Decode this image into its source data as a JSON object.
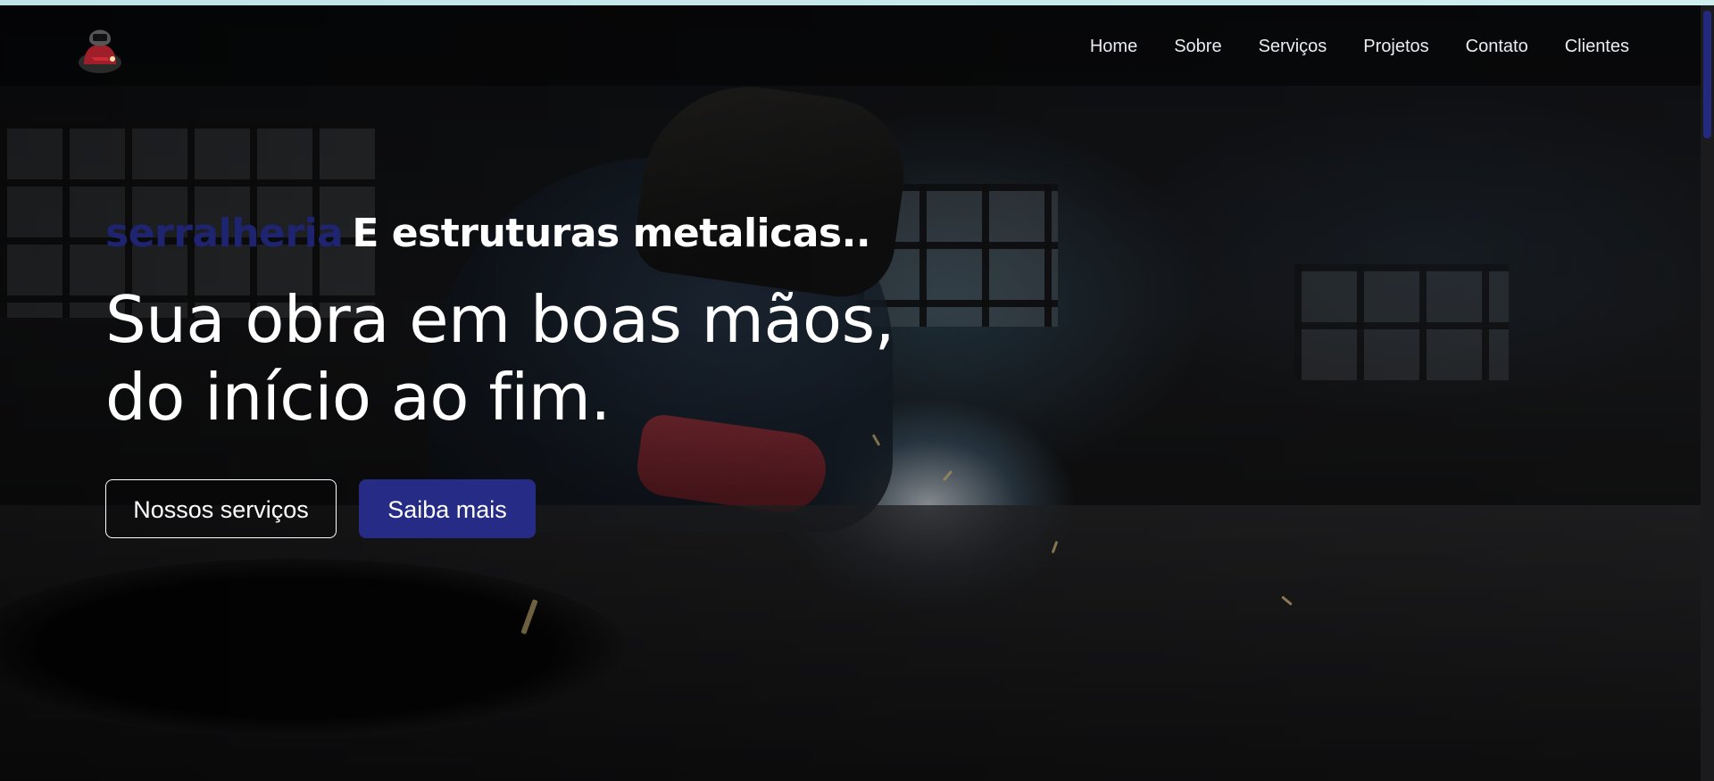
{
  "header": {
    "logo_alt": "Welder logo",
    "nav": [
      {
        "label": "Home"
      },
      {
        "label": "Sobre"
      },
      {
        "label": "Serviços"
      },
      {
        "label": "Projetos"
      },
      {
        "label": "Contato"
      },
      {
        "label": "Clientes"
      }
    ]
  },
  "hero": {
    "tagline_brand": "serralheria",
    "tagline_rest": "E estruturas metalicas..",
    "headline_line1": "Sua obra em boas mãos,",
    "headline_line2": "do início ao fim.",
    "buttons": {
      "services_label": "Nossos serviços",
      "more_label": "Saiba mais"
    }
  },
  "colors": {
    "brand_blue": "#262b86",
    "brand_text": "#1f2470",
    "top_strip": "#c6e9ec"
  }
}
